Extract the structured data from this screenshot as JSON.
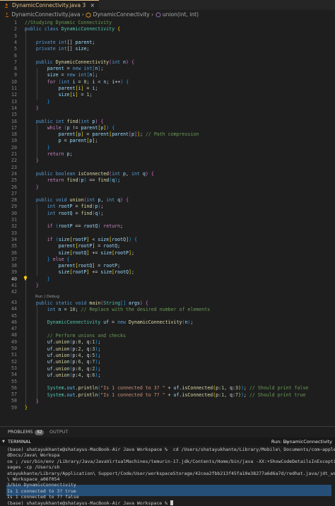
{
  "tab": {
    "filename": "DynamicConnectivity.java",
    "modified_count": "3",
    "close": "×"
  },
  "breadcrumb": {
    "file": "DynamicConnectivity.java",
    "sep1": "›",
    "class_name": "DynamicConnectivity",
    "sep2": "›",
    "method": "union(int, int)"
  },
  "editor": {
    "line_numbers": [
      "1",
      "2",
      "3",
      "4",
      "5",
      "6",
      "7",
      "8",
      "9",
      "10",
      "11",
      "12",
      "13",
      "14",
      "15",
      "16",
      "17",
      "18",
      "19",
      "20",
      "21",
      "22",
      "23",
      "24",
      "25",
      "26",
      "27",
      "28",
      "29",
      "30",
      "31",
      "32",
      "33",
      "34",
      "35",
      "36",
      "37",
      "38",
      "39",
      "40",
      "41",
      "42",
      "43",
      "44",
      "45",
      "46",
      "47",
      "48",
      "49",
      "50",
      "51",
      "52",
      "53",
      "54",
      "55",
      "56",
      "57",
      "58",
      "59"
    ],
    "active_line": "40",
    "codelens": "Run | Debug"
  },
  "code": {
    "l1": "//Studying Dynamic Connectivity",
    "l2_a": "public",
    "l2_b": "class",
    "l2_c": "DynamicConnectivity",
    "l4_a": "private",
    "l4_b": "int",
    "l4_c": "parent",
    "l5_a": "private",
    "l5_b": "int",
    "l5_c": "size",
    "l7_a": "public",
    "l7_b": "DynamicConnectivity",
    "l7_c": "int",
    "l7_d": "n",
    "l8_a": "parent",
    "l8_b": "new",
    "l8_c": "int",
    "l8_d": "n",
    "l9_a": "size",
    "l9_b": "new",
    "l9_c": "int",
    "l9_d": "n",
    "l10_a": "for",
    "l10_b": "int",
    "l10_c": "i",
    "l10_d": "0",
    "l10_e": "i",
    "l10_f": "n",
    "l10_g": "i",
    "l11_a": "parent",
    "l11_b": "i",
    "l11_c": "i",
    "l12_a": "size",
    "l12_b": "i",
    "l12_c": "1",
    "l16_a": "public",
    "l16_b": "int",
    "l16_c": "find",
    "l16_d": "int",
    "l16_e": "p",
    "l17_a": "while",
    "l17_b": "p",
    "l17_c": "parent",
    "l17_d": "p",
    "l18_a": "parent",
    "l18_b": "p",
    "l18_c": "parent",
    "l18_d": "parent",
    "l18_e": "p",
    "l18_f": "// Path compression",
    "l19_a": "p",
    "l19_b": "parent",
    "l19_c": "p",
    "l21_a": "return",
    "l21_b": "p",
    "l24_a": "public",
    "l24_b": "boolean",
    "l24_c": "isConnected",
    "l24_d": "int",
    "l24_e": "p",
    "l24_f": "int",
    "l24_g": "q",
    "l25_a": "return",
    "l25_b": "find",
    "l25_c": "p",
    "l25_d": "find",
    "l25_e": "q",
    "l28_a": "public",
    "l28_b": "void",
    "l28_c": "union",
    "l28_d": "int",
    "l28_e": "p",
    "l28_f": "int",
    "l28_g": "q",
    "l29_a": "int",
    "l29_b": "rootP",
    "l29_c": "find",
    "l29_d": "p",
    "l30_a": "int",
    "l30_b": "rootQ",
    "l30_c": "find",
    "l30_d": "q",
    "l32_a": "if",
    "l32_b": "rootP",
    "l32_c": "rootQ",
    "l32_d": "return",
    "l34_a": "if",
    "l34_b": "size",
    "l34_c": "rootP",
    "l34_d": "size",
    "l34_e": "rootQ",
    "l35_a": "parent",
    "l35_b": "rootP",
    "l35_c": "rootQ",
    "l36_a": "size",
    "l36_b": "rootQ",
    "l36_c": "size",
    "l36_d": "rootP",
    "l37_a": "else",
    "l38_a": "parent",
    "l38_b": "rootQ",
    "l38_c": "rootP",
    "l39_a": "size",
    "l39_b": "rootP",
    "l39_c": "size",
    "l39_d": "rootQ",
    "l43_a": "public",
    "l43_b": "static",
    "l43_c": "void",
    "l43_d": "main",
    "l43_e": "String",
    "l43_f": "args",
    "l44_a": "int",
    "l44_b": "n",
    "l44_c": "10",
    "l44_d": "// Replace with the desired number of elements",
    "l46_a": "DynamicConnectivity",
    "l46_b": "uf",
    "l46_c": "new",
    "l46_d": "DynamicConnectivity",
    "l46_e": "n",
    "l48": "// Perform unions and checks",
    "unions": [
      {
        "p": "p:",
        "a": "0",
        "q": "q:",
        "b": "1"
      },
      {
        "p": "p:",
        "a": "2",
        "q": "q:",
        "b": "3"
      },
      {
        "p": "p:",
        "a": "4",
        "q": "q:",
        "b": "5"
      },
      {
        "p": "p:",
        "a": "6",
        "q": "q:",
        "b": "7"
      },
      {
        "p": "p:",
        "a": "0",
        "q": "q:",
        "b": "2"
      },
      {
        "p": "p:",
        "a": "4",
        "q": "q:",
        "b": "6"
      }
    ],
    "uf": "uf",
    "union": "union",
    "l56_a": "System",
    "l56_b": "out",
    "l56_c": "println",
    "l56_d": "\"Is 1 connected to 3? \"",
    "l56_e": "uf",
    "l56_f": "isConnected",
    "l56_g": "p:",
    "l56_h": "1",
    "l56_i": "q:",
    "l56_j": "3",
    "l56_k": "// Should print false",
    "l57_a": "System",
    "l57_b": "out",
    "l57_c": "println",
    "l57_d": "\"Is 1 connected to 7? \"",
    "l57_e": "uf",
    "l57_f": "isConnected",
    "l57_g": "p:",
    "l57_h": "1",
    "l57_i": "q:",
    "l57_j": "7",
    "l57_k": "// Should print true"
  },
  "panel": {
    "problems_label": "PROBLEMS",
    "problems_count": "62",
    "output_label": "OUTPUT",
    "terminal_label": "TERMINAL",
    "run_label": "Run: DynamicConnectivity"
  },
  "terminal": {
    "lines": [
      "(base) shatayukhante@shatayus-MacBook-Air Java Workspace %  cd /Users/shatayukhante/Library/Mobile\\ Documents/com~apple~Clou",
      "dDocs/Java\\ Workspa",
      "ce ; /usr/bin/env /Library/Java/JavaVirtualMachines/temurin-17.jdk/Contents/Home/bin/java -XX:+ShowCodeDetailsInExceptionMes",
      "sages -cp /Users/sh",
      "atayukhante/Library/Application\\ Support/Code/User/workspaceStorage/42cea2fbb213f45fa10e38277a6d6a7d/redhat.java/jdt_ws/Java",
      "\\ Workspace_a06f054",
      "3/bin DynamicConnectivity",
      "Is 1 connected to 3? true",
      "Is 1 connected to 7? false",
      "(base) shatayukhante@shatayus-MacBook-Air Java Workspace % "
    ]
  },
  "colors": {
    "bg": "#1e1e1e",
    "keyword": "#569cd6",
    "control": "#c586c0",
    "type": "#4ec9b0",
    "function": "#dcdcaa",
    "variable": "#9cdcfe",
    "number": "#b5cea8",
    "comment": "#6a9955",
    "string": "#ce9178",
    "selection": "#264f78"
  }
}
